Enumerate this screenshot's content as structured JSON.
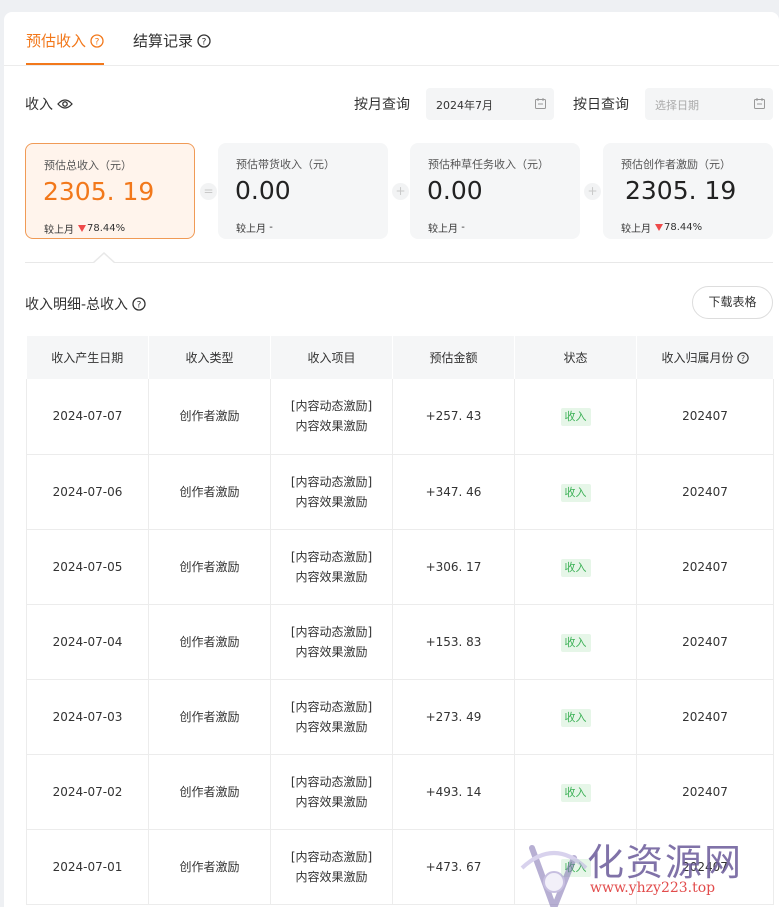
{
  "tabs": [
    {
      "label": "预估收入"
    },
    {
      "label": "结算记录"
    }
  ],
  "income": {
    "title": "收入",
    "month_label": "按月查询",
    "month_value": "2024年7月",
    "day_label": "按日查询",
    "day_placeholder": "选择日期"
  },
  "cards": [
    {
      "title": "预估总收入（元）",
      "value": "2305. 19",
      "compare_label": "较上月",
      "compare_value": "78.44%"
    },
    {
      "title": "预估带货收入（元）",
      "value": "0.00",
      "compare_label": "较上月",
      "compare_value": "-"
    },
    {
      "title": "预估种草任务收入（元）",
      "value": "0.00",
      "compare_label": "较上月",
      "compare_value": "-"
    },
    {
      "title": "预估创作者激励（元）",
      "value": "2305. 19",
      "compare_label": "较上月",
      "compare_value": "78.44%"
    }
  ],
  "operators": [
    "=",
    "+",
    "+"
  ],
  "details": {
    "title": "收入明细-总收入",
    "download_label": "下载表格",
    "columns": [
      "收入产生日期",
      "收入类型",
      "收入项目",
      "预估金额",
      "状态",
      "收入归属月份"
    ],
    "rows": [
      {
        "date": "2024-07-07",
        "type": "创作者激励",
        "item1": "[内容动态激励]",
        "item2": "内容效果激励",
        "amount": "+257. 43",
        "status": "收入",
        "month": "202407"
      },
      {
        "date": "2024-07-06",
        "type": "创作者激励",
        "item1": "[内容动态激励]",
        "item2": "内容效果激励",
        "amount": "+347. 46",
        "status": "收入",
        "month": "202407"
      },
      {
        "date": "2024-07-05",
        "type": "创作者激励",
        "item1": "[内容动态激励]",
        "item2": "内容效果激励",
        "amount": "+306. 17",
        "status": "收入",
        "month": "202407"
      },
      {
        "date": "2024-07-04",
        "type": "创作者激励",
        "item1": "[内容动态激励]",
        "item2": "内容效果激励",
        "amount": "+153. 83",
        "status": "收入",
        "month": "202407"
      },
      {
        "date": "2024-07-03",
        "type": "创作者激励",
        "item1": "[内容动态激励]",
        "item2": "内容效果激励",
        "amount": "+273. 49",
        "status": "收入",
        "month": "202407"
      },
      {
        "date": "2024-07-02",
        "type": "创作者激励",
        "item1": "[内容动态激励]",
        "item2": "内容效果激励",
        "amount": "+493. 14",
        "status": "收入",
        "month": "202407"
      },
      {
        "date": "2024-07-01",
        "type": "创作者激励",
        "item1": "[内容动态激励]",
        "item2": "内容效果激励",
        "amount": "+473. 67",
        "status": "收入",
        "month": "202407"
      }
    ]
  },
  "watermark": {
    "text": "化资源网",
    "url": "www.yhzy223.top"
  },
  "colors": {
    "accent": "#f2781b",
    "down": "#ef4a4a",
    "badge_bg": "#e6f6e8",
    "badge_fg": "#3cb156"
  }
}
